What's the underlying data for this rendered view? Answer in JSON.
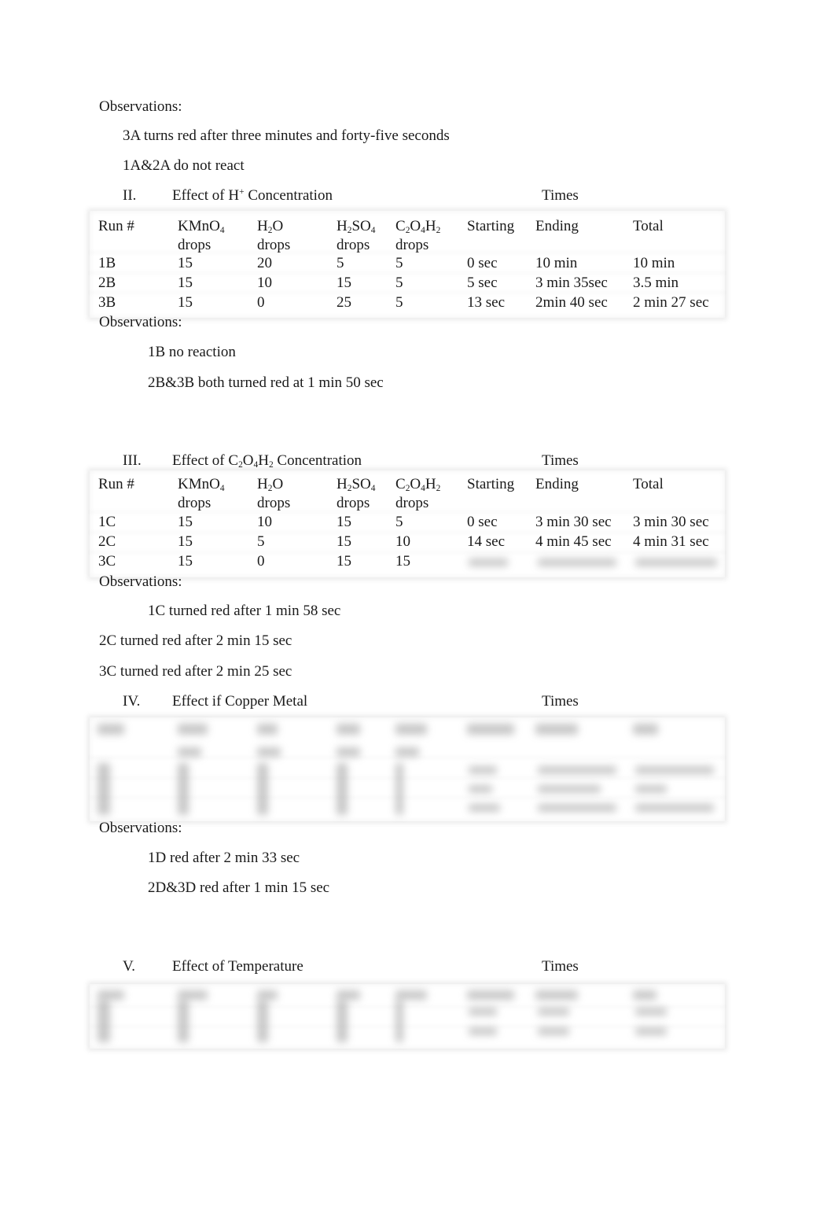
{
  "section1_observations": {
    "label": "Observations:",
    "items": [
      "3A turns red after three minutes and forty-five seconds",
      "1A&2A do not react"
    ]
  },
  "section2": {
    "number": "II.",
    "title_prefix": "Effect of H",
    "title_sup": "+",
    "title_suffix": " Concentration",
    "times_label": "Times",
    "table": {
      "headers": {
        "run": "Run #",
        "kmno4_base": "KMnO",
        "kmno4_sub": "4",
        "h2o_a": "H",
        "h2o_sub": "2",
        "h2o_b": "O",
        "h2so4_a": "H",
        "h2so4_sub1": "2",
        "h2so4_b": "SO",
        "h2so4_sub2": "4",
        "c2o4h2_a": "C",
        "c2o4h2_sub1": "2",
        "c2o4h2_b": "O",
        "c2o4h2_sub2": "4",
        "c2o4h2_c": "H",
        "c2o4h2_sub3": "2",
        "drops": "drops",
        "starting": "Starting",
        "ending": "Ending",
        "total": "Total"
      },
      "rows": [
        {
          "run": "1B",
          "kmno4": "15",
          "h2o": "20",
          "h2so4": "5",
          "c2o4h2": "5",
          "starting": "0 sec",
          "ending": "10 min",
          "total": "10 min"
        },
        {
          "run": "2B",
          "kmno4": "15",
          "h2o": "10",
          "h2so4": "15",
          "c2o4h2": "5",
          "starting": "5 sec",
          "ending": "3 min 35sec",
          "total": "3.5 min"
        },
        {
          "run": "3B",
          "kmno4": "15",
          "h2o": "0",
          "h2so4": "25",
          "c2o4h2": "5",
          "starting": "13 sec",
          "ending": "2min 40 sec",
          "total": "2 min 27 sec"
        }
      ]
    },
    "observations": {
      "label": "Observations:",
      "items": [
        "1B no reaction",
        "2B&3B both turned red at 1 min 50 sec"
      ]
    }
  },
  "section3": {
    "number": "III.",
    "title_prefix": "Effect of C",
    "title_sub1": "2",
    "title_mid1": "O",
    "title_sub2": "4",
    "title_mid2": "H",
    "title_sub3": "2",
    "title_suffix": " Concentration",
    "times_label": "Times",
    "table": {
      "rows": [
        {
          "run": "1C",
          "kmno4": "15",
          "h2o": "10",
          "h2so4": "15",
          "c2o4h2": "5",
          "starting": "0 sec",
          "ending": "3 min 30 sec",
          "total": "3 min 30 sec"
        },
        {
          "run": "2C",
          "kmno4": "15",
          "h2o": "5",
          "h2so4": "15",
          "c2o4h2": "10",
          "starting": "14 sec",
          "ending": "4 min 45 sec",
          "total": "4 min 31 sec"
        },
        {
          "run": "3C",
          "kmno4": "15",
          "h2o": "0",
          "h2so4": "15",
          "c2o4h2": "15",
          "starting": "",
          "ending": "",
          "total": ""
        }
      ]
    },
    "observations": {
      "label": "Observations:",
      "items": [
        "1C turned red after 1 min 58 sec",
        "2C turned red after 2 min 15 sec",
        "3C turned red after 2 min 25 sec"
      ]
    }
  },
  "section4": {
    "number": "IV.",
    "title": "Effect if Copper Metal",
    "times_label": "Times",
    "observations": {
      "label": "Observations:",
      "items": [
        "1D red after 2 min 33 sec",
        "2D&3D red after 1 min 15 sec"
      ]
    }
  },
  "section5": {
    "number": "V.",
    "title": "Effect of Temperature",
    "times_label": "Times"
  }
}
